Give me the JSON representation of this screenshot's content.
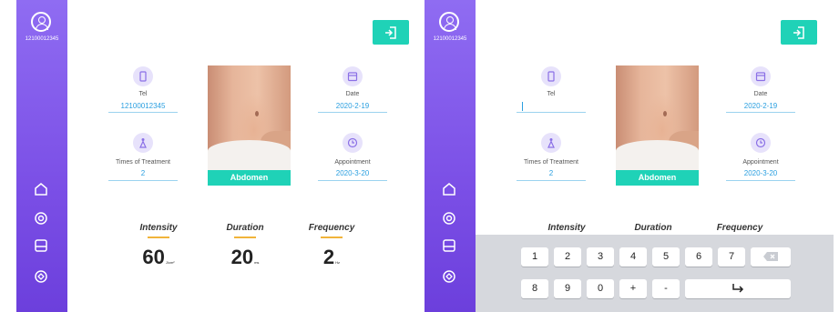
{
  "user": {
    "id": "12100012345"
  },
  "fields": {
    "tel": {
      "label": "Tel",
      "value": "12100012345"
    },
    "date": {
      "label": "Date",
      "value": "2020-2-19"
    },
    "times": {
      "label": "Times of Treatment",
      "value": "2"
    },
    "appointment": {
      "label": "Appointment",
      "value": "2020-3-20"
    }
  },
  "treatment_area": "Abdomen",
  "params": {
    "intensity": {
      "label": "Intensity",
      "value": "60",
      "unit": "J/cm²"
    },
    "duration": {
      "label": "Duration",
      "value": "20",
      "unit": "ms"
    },
    "frequency": {
      "label": "Frequency",
      "value": "2",
      "unit": "Hz"
    }
  },
  "keyboard": {
    "row1": [
      "1",
      "2",
      "3",
      "4",
      "5",
      "6",
      "7"
    ],
    "row2": [
      "8",
      "9",
      "0",
      "+",
      "-"
    ]
  },
  "colors": {
    "sidebar": "#7b4fe6",
    "accent": "#1fd2b7",
    "value": "#2a9fe0",
    "bar": "#f1b43a"
  },
  "icons": {
    "sidebar": [
      "user-icon",
      "home-icon",
      "settings-icon",
      "save-icon",
      "target-icon"
    ],
    "fields": [
      "phone-icon",
      "calendar-icon",
      "body-icon",
      "clock-icon"
    ],
    "exit": "exit-icon"
  }
}
